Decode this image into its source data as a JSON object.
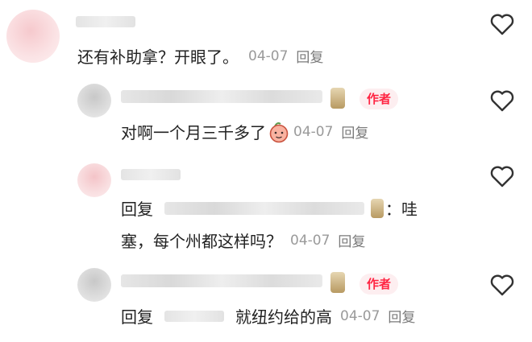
{
  "comments": [
    {
      "text": "还有补助拿？开眼了。",
      "date": "04-07",
      "reply_label": "回复"
    }
  ],
  "replies": [
    {
      "badge": "作者",
      "text": "对啊一个月三千多了",
      "emoji": "peach-face-emoji",
      "date": "04-07",
      "reply_label": "回复"
    },
    {
      "prefix": "回复",
      "after_name": "：哇",
      "text_line2": "塞，每个州都这样吗？",
      "date": "04-07",
      "reply_label": "回复"
    },
    {
      "badge": "作者",
      "prefix": "回复",
      "text": "就纽约给的高",
      "date": "04-07",
      "reply_label": "回复"
    }
  ],
  "icons": {
    "like": "heart-outline-icon",
    "badge_medal": "medal-icon"
  },
  "colors": {
    "accent": "#ff2442",
    "badge_bg": "#fdeef0",
    "meta": "#9a9a9a"
  }
}
